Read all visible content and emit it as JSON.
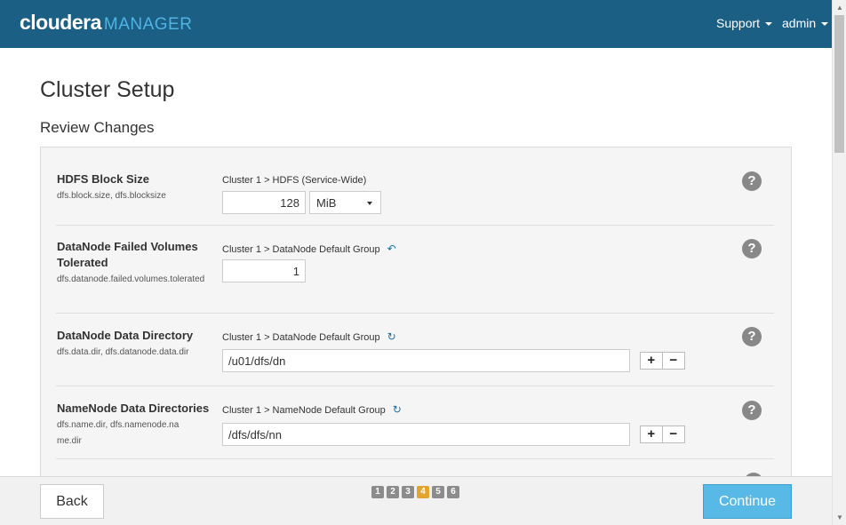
{
  "header": {
    "brand": "cloudera",
    "product": "MANAGER",
    "menus": [
      {
        "label": "Support"
      },
      {
        "label": "admin"
      }
    ]
  },
  "page": {
    "title": "Cluster Setup",
    "subtitle": "Review Changes"
  },
  "rows": [
    {
      "label": "HDFS Block Size",
      "keys": "dfs.block.size, dfs.blocksize",
      "scope": "Cluster 1 > HDFS (Service-Wide)",
      "value": "128",
      "unit": "MiB"
    },
    {
      "label": "DataNode Failed Volumes Tolerated",
      "keys": "dfs.datanode.failed.volumes.tolerated",
      "scope": "Cluster 1 > DataNode Default Group",
      "scope_icon": "undo-arrow-icon",
      "value": "1"
    },
    {
      "label": "DataNode Data Directory",
      "keys": "dfs.data.dir, dfs.datanode.data.dir",
      "scope": "Cluster 1 > DataNode Default Group",
      "scope_icon": "refresh-icon",
      "value": "/u01/dfs/dn"
    },
    {
      "label": "NameNode Data Directories",
      "keys": "dfs.name.dir, dfs.namenode.name.dir",
      "scope": "Cluster 1 > NameNode Default Group",
      "scope_icon": "refresh-icon",
      "value": "/dfs/dfs/nn"
    }
  ],
  "controls": {
    "plus": "+",
    "minus": "−",
    "help": "?"
  },
  "footer": {
    "back_label": "Back",
    "continue_label": "Continue",
    "steps": [
      "1",
      "2",
      "3",
      "4",
      "5",
      "6"
    ],
    "active_step": "4"
  },
  "colors": {
    "header_bg": "#1b5f84",
    "brand_accent": "#4fb3e4",
    "continue_bg": "#58b9e6",
    "active_step": "#e2a52e"
  }
}
